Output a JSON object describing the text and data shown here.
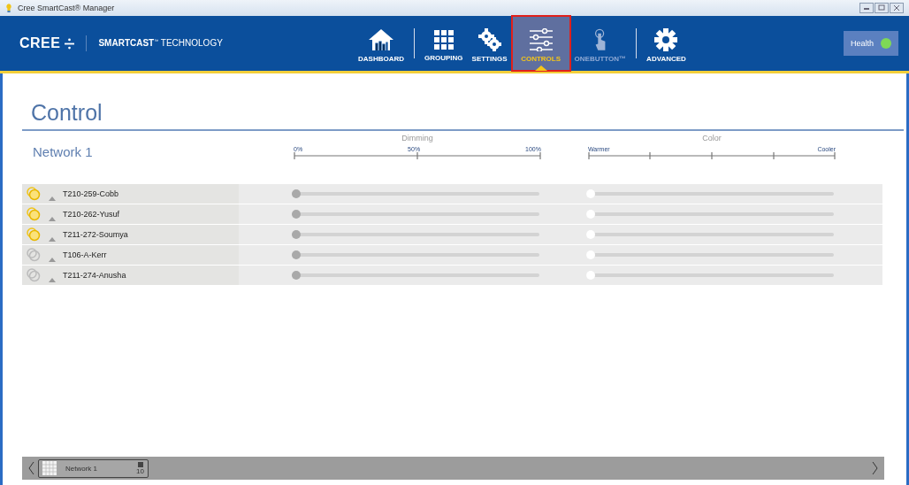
{
  "window": {
    "title": "Cree SmartCast® Manager"
  },
  "brand": {
    "logo": "CREE",
    "product": "SMARTCAST",
    "product_mark": "™",
    "tagline": "TECHNOLOGY"
  },
  "nav": [
    {
      "label": "DASHBOARD",
      "kind": "house",
      "selected": false,
      "disabled": false
    },
    {
      "label": "GROUPING",
      "kind": "grid",
      "selected": false,
      "disabled": false
    },
    {
      "label": "SETTINGS",
      "kind": "gears",
      "selected": false,
      "disabled": false
    },
    {
      "label": "CONTROLS",
      "kind": "sliders",
      "selected": true,
      "disabled": false
    },
    {
      "label": "ONEBUTTON™",
      "kind": "finger",
      "selected": false,
      "disabled": true
    },
    {
      "label": "ADVANCED",
      "kind": "gear",
      "selected": false,
      "disabled": false
    }
  ],
  "health": {
    "label": "Health",
    "color": "#7ed957"
  },
  "page_title": "Control",
  "network": {
    "name": "Network 1"
  },
  "dimming_scale": {
    "title": "Dimming",
    "labels": [
      "0%",
      "50%",
      "100%"
    ]
  },
  "color_scale": {
    "title": "Color",
    "start": "Warmer",
    "end": "Cooler"
  },
  "fixtures": [
    {
      "name": "T210-259-Cobb",
      "on": true,
      "dimming": {
        "level": 0
      },
      "color": {
        "level": 0
      }
    },
    {
      "name": "T210-262-Yusuf",
      "on": true,
      "dimming": {
        "level": 0
      },
      "color": {
        "level": 0
      }
    },
    {
      "name": "T211-272-Soumya",
      "on": true,
      "dimming": {
        "level": 0
      },
      "color": {
        "level": 0
      }
    },
    {
      "name": "T106-A-Kerr",
      "on": false,
      "dimming": {
        "level": 0
      },
      "color": {
        "level": 0
      }
    },
    {
      "name": "T211-274-Anusha",
      "on": false,
      "dimming": {
        "level": 0
      },
      "color": {
        "level": 0
      }
    }
  ],
  "bottom_tabs": [
    {
      "label": "Network 1",
      "count": "10"
    }
  ]
}
